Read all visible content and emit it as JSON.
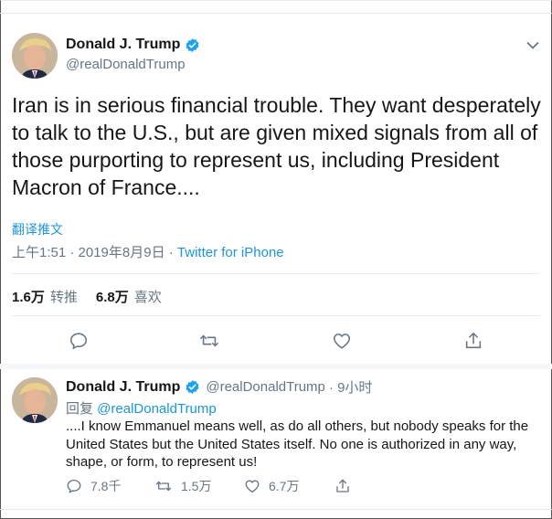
{
  "colors": {
    "accent": "#1b95e0",
    "text": "#14171a",
    "muted": "#657786",
    "divider": "#e6ecf0"
  },
  "main_tweet": {
    "author_name": "Donald J. Trump",
    "author_handle": "@realDonaldTrump",
    "verified_icon": "verified-badge-icon",
    "menu_icon": "chevron-down-icon",
    "text": "Iran is in serious financial trouble. They want desperately to talk to the U.S., but are given mixed signals from all of those purporting to represent us, including President Macron of France....",
    "translate_label": "翻译推文",
    "time": "上午1:51 · 2019年8月9日 · ",
    "source": "Twitter for iPhone",
    "retweets_count": "1.6万",
    "retweets_label": "转推",
    "likes_count": "6.8万",
    "likes_label": "喜欢",
    "action_icons": [
      "reply-icon",
      "retweet-icon",
      "like-icon",
      "share-icon"
    ]
  },
  "reply_tweet": {
    "author_name": "Donald J. Trump",
    "author_handle": "@realDonaldTrump",
    "time": "· 9小时",
    "reply_prefix": "回复 ",
    "reply_mention": "@realDonaldTrump",
    "text": "....I know Emmanuel means well, as do all others, but nobody speaks for the United States but the United States itself. No one is authorized in any way, shape, or form, to represent us!",
    "reply_count": "7.8千",
    "retweet_count": "1.5万",
    "like_count": "6.7万"
  }
}
